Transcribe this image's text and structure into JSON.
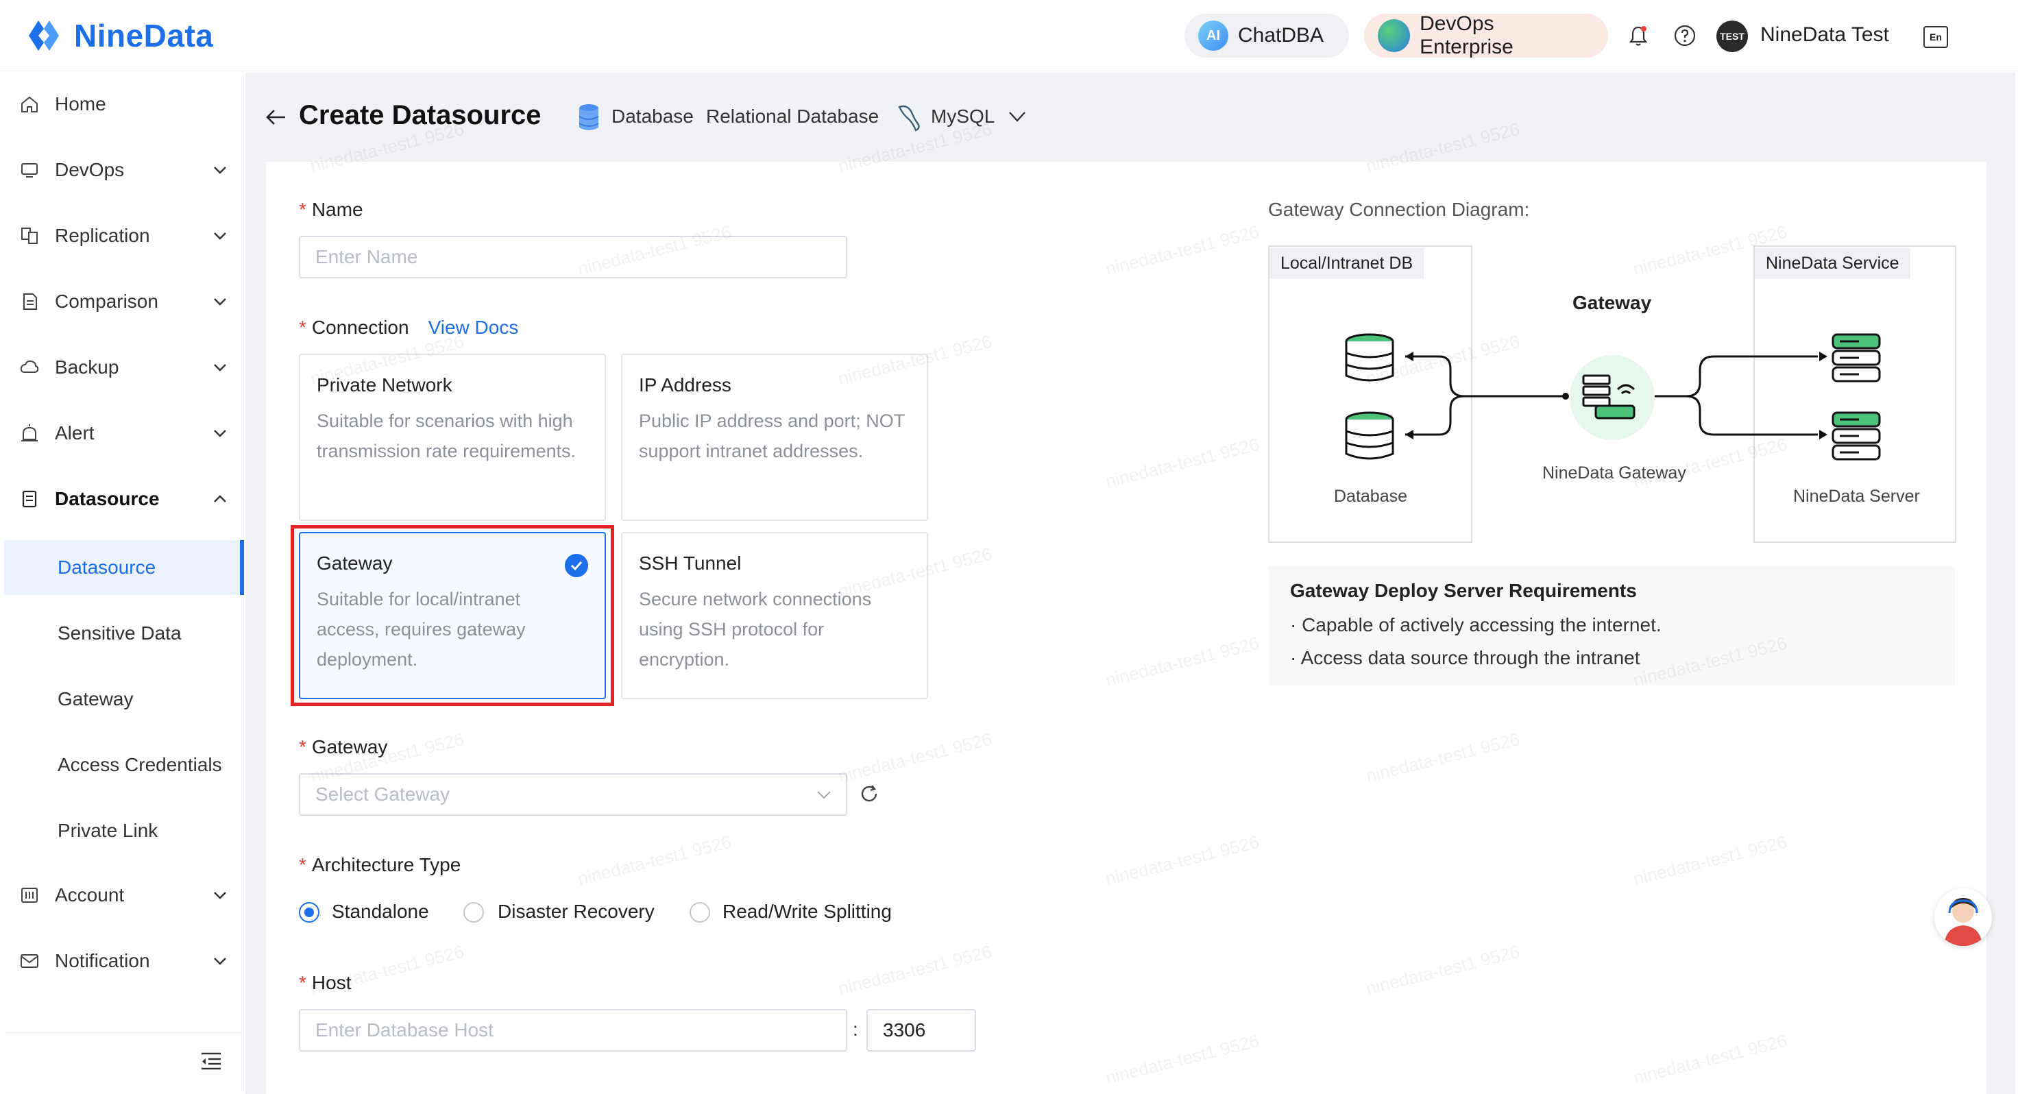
{
  "app": {
    "name": "NineData"
  },
  "header": {
    "chatdba_label": "ChatDBA",
    "chatdba_badge": "AI",
    "devops_label": "DevOps Enterprise",
    "user_badge": "TEST",
    "user_name": "NineData Test",
    "lang_icon_text": "En"
  },
  "sidebar": {
    "items": [
      {
        "label": "Home",
        "icon": "home-icon"
      },
      {
        "label": "DevOps",
        "icon": "devops-icon"
      },
      {
        "label": "Replication",
        "icon": "replication-icon"
      },
      {
        "label": "Comparison",
        "icon": "comparison-icon"
      },
      {
        "label": "Backup",
        "icon": "backup-icon"
      },
      {
        "label": "Alert",
        "icon": "alert-icon"
      },
      {
        "label": "Datasource",
        "icon": "datasource-icon"
      }
    ],
    "sub_items": [
      {
        "label": "Datasource",
        "active": true
      },
      {
        "label": "Sensitive Data"
      },
      {
        "label": "Gateway"
      },
      {
        "label": "Access Credentials"
      },
      {
        "label": "Private Link"
      }
    ],
    "bottom_items": [
      {
        "label": "Account",
        "icon": "account-icon"
      },
      {
        "label": "Notification",
        "icon": "notification-icon"
      }
    ]
  },
  "page": {
    "title": "Create Datasource",
    "crumb_db": "Database",
    "crumb_type": "Relational Database",
    "crumb_engine": "MySQL"
  },
  "form": {
    "name_label": "Name",
    "name_placeholder": "Enter Name",
    "connection_label": "Connection",
    "view_docs": "View Docs",
    "connections": [
      {
        "title": "Private Network",
        "desc": "Suitable for scenarios with high transmission rate requirements."
      },
      {
        "title": "IP Address",
        "desc": "Public IP address and port; NOT support intranet addresses."
      },
      {
        "title": "Gateway",
        "desc": "Suitable for local/intranet access, requires gateway deployment.",
        "selected": true
      },
      {
        "title": "SSH Tunnel",
        "desc": "Secure network connections using SSH protocol for encryption."
      }
    ],
    "gateway_label": "Gateway",
    "gateway_placeholder": "Select Gateway",
    "arch_label": "Architecture Type",
    "arch_options": [
      "Standalone",
      "Disaster Recovery",
      "Read/Write Splitting"
    ],
    "arch_selected": "Standalone",
    "host_label": "Host",
    "host_placeholder": "Enter Database Host",
    "port_separator": ":",
    "port_value": "3306"
  },
  "diagram": {
    "title": "Gateway Connection Diagram:",
    "local_tag": "Local/Intranet DB",
    "service_tag": "NineData Service",
    "gateway_title": "Gateway",
    "database_caption": "Database",
    "gateway_caption": "NineData Gateway",
    "server_caption": "NineData Server"
  },
  "requirements": {
    "title": "Gateway Deploy Server Requirements",
    "lines": [
      "Capable of actively accessing the internet.",
      "Access data source through the intranet"
    ],
    "bullet": "·"
  },
  "watermark": "ninedata-test1 9526",
  "colors": {
    "accent": "#1c6fe8",
    "required": "#e8443a",
    "highlight": "#e02424",
    "db_green": "#4cc27a"
  }
}
